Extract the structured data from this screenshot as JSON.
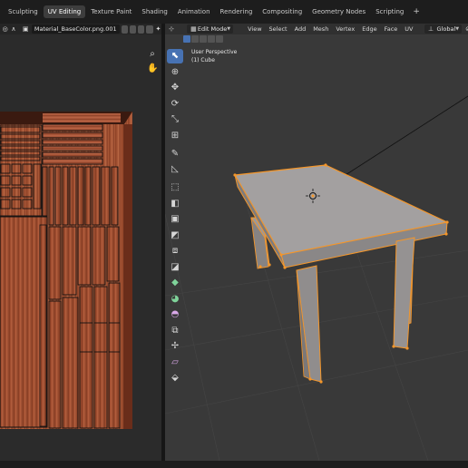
{
  "workspace_tabs": [
    {
      "label": "Sculpting",
      "active": false
    },
    {
      "label": "UV Editing",
      "active": true
    },
    {
      "label": "Texture Paint",
      "active": false
    },
    {
      "label": "Shading",
      "active": false
    },
    {
      "label": "Animation",
      "active": false
    },
    {
      "label": "Rendering",
      "active": false
    },
    {
      "label": "Compositing",
      "active": false
    },
    {
      "label": "Geometry Nodes",
      "active": false
    },
    {
      "label": "Scripting",
      "active": false
    }
  ],
  "add_workspace": "+",
  "uv_editor": {
    "image_name": "Material_BaseColor.png.001",
    "nav_icons": [
      "magnifier-icon",
      "hand-pan-icon"
    ]
  },
  "viewport": {
    "mode": "Edit Mode",
    "menus": [
      "View",
      "Select",
      "Add",
      "Mesh",
      "Vertex",
      "Edge",
      "Face",
      "UV"
    ],
    "orientation": "Global",
    "info_line1": "User Perspective",
    "info_line2": "(1) Cube",
    "tools": [
      {
        "icon": "select-box-icon",
        "glyph": "⬉",
        "active": true
      },
      {
        "icon": "cursor-icon",
        "glyph": "⊕",
        "active": false
      },
      {
        "icon": "move-icon",
        "glyph": "✥",
        "active": false
      },
      {
        "icon": "rotate-icon",
        "glyph": "⟳",
        "active": false
      },
      {
        "icon": "scale-icon",
        "glyph": "⤡",
        "active": false
      },
      {
        "icon": "transform-icon",
        "glyph": "⊞",
        "active": false
      },
      {
        "icon": "annotate-icon",
        "glyph": "✎",
        "active": false
      },
      {
        "icon": "measure-icon",
        "glyph": "◺",
        "active": false
      },
      {
        "icon": "add-cube-icon",
        "glyph": "⬚",
        "active": false
      },
      {
        "icon": "extrude-icon",
        "glyph": "◧",
        "active": false
      },
      {
        "icon": "inset-icon",
        "glyph": "▣",
        "active": false
      },
      {
        "icon": "bevel-icon",
        "glyph": "◩",
        "active": false
      },
      {
        "icon": "loop-cut-icon",
        "glyph": "⧈",
        "active": false
      },
      {
        "icon": "knife-icon",
        "glyph": "◪",
        "active": false
      },
      {
        "icon": "poly-build-icon",
        "glyph": "◆",
        "active": false
      },
      {
        "icon": "spin-icon",
        "glyph": "◕",
        "active": false
      },
      {
        "icon": "smooth-icon",
        "glyph": "◓",
        "active": false
      },
      {
        "icon": "edge-slide-icon",
        "glyph": "⧉",
        "active": false
      },
      {
        "icon": "shrink-fatten-icon",
        "glyph": "✢",
        "active": false
      },
      {
        "icon": "shear-icon",
        "glyph": "▱",
        "active": false
      },
      {
        "icon": "rip-region-icon",
        "glyph": "⬙",
        "active": false
      }
    ]
  },
  "colors": {
    "accent": "#4772b3",
    "selection": "#f4962a",
    "wood_dark": "#7a3522",
    "wood_light": "#c06a45",
    "mesh_face": "#a3a0a0"
  }
}
